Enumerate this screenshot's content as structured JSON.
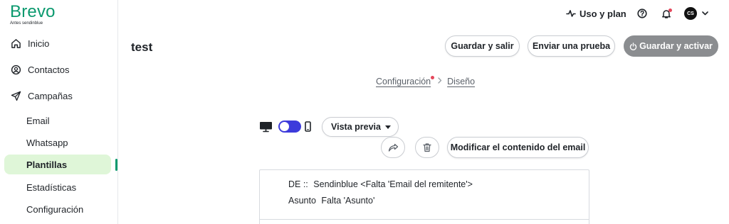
{
  "brand": {
    "name": "Brevo",
    "subtitle": "Antes sendinblue",
    "color": "#0b996e"
  },
  "sidebar": {
    "items": [
      {
        "label": "Inicio",
        "icon": "home-icon"
      },
      {
        "label": "Contactos",
        "icon": "contacts-icon"
      },
      {
        "label": "Campañas",
        "icon": "send-icon"
      }
    ],
    "subitems": [
      {
        "label": "Email"
      },
      {
        "label": "Whatsapp"
      },
      {
        "label": "Plantillas",
        "active": true
      },
      {
        "label": "Estadísticas"
      },
      {
        "label": "Configuración"
      }
    ]
  },
  "topbar": {
    "usage_label": "Uso y plan",
    "avatar_initials": "CS"
  },
  "page": {
    "title": "test"
  },
  "actions": {
    "save_exit": "Guardar y salir",
    "send_test": "Enviar una prueba",
    "save_activate": "Guardar y activar"
  },
  "breadcrumb": {
    "step1": "Configuración",
    "step2": "Diseño"
  },
  "preview": {
    "mode_label": "Vista previa",
    "modify_label": "Modificar el contenido del email"
  },
  "email": {
    "from_label": "DE ::",
    "from_value": "Sendinblue <Falta 'Email del remitente'>",
    "subject_label": "Asunto",
    "subject_value": "Falta 'Asunto'"
  },
  "colors": {
    "accent": "#0b996e",
    "toggle": "#3d3bdb",
    "active_bg": "#dff6d8",
    "alert_dot": "#e4475b"
  }
}
